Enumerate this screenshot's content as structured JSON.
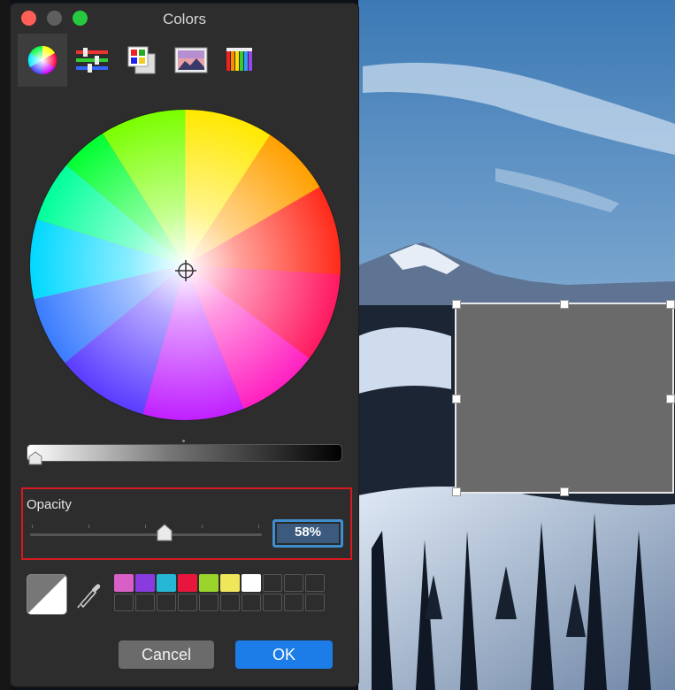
{
  "window": {
    "title": "Colors",
    "traffic_lights": {
      "close": "#ff5f57",
      "minimize": "#5f5f5f",
      "zoom": "#27c93f"
    }
  },
  "toolbar": {
    "tools": [
      {
        "icon": "color-wheel-icon",
        "active": true
      },
      {
        "icon": "color-sliders-icon",
        "active": false
      },
      {
        "icon": "color-palettes-icon",
        "active": false
      },
      {
        "icon": "image-palettes-icon",
        "active": false
      },
      {
        "icon": "pencils-icon",
        "active": false
      }
    ]
  },
  "opacity": {
    "label": "Opacity",
    "value": "58%",
    "slider_fraction": 0.58
  },
  "swatches": {
    "colors": [
      "#d85fc6",
      "#8a3be0",
      "#27b7d6",
      "#e8163c",
      "#9ad42a",
      "#efe65a",
      "#ffffff"
    ],
    "empty_cells": 13
  },
  "buttons": {
    "cancel": "Cancel",
    "ok": "OK"
  },
  "accent": {
    "ok_blue": "#1c7de8",
    "highlight_red": "#d71920"
  }
}
